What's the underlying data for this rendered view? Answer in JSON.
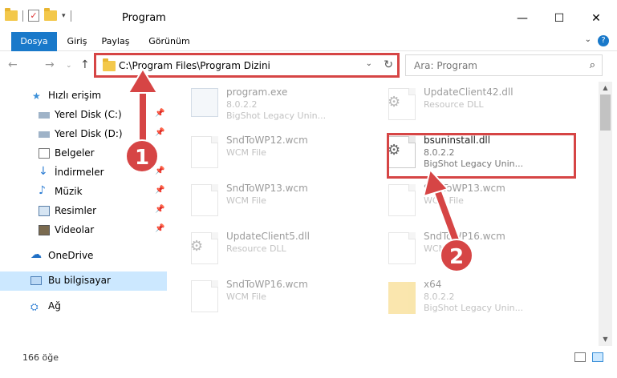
{
  "window": {
    "title": "Program",
    "minimize": "—",
    "maximize": "☐",
    "close": "✕"
  },
  "ribbon": {
    "tabs": [
      "Dosya",
      "Giriş",
      "Paylaş",
      "Görünüm"
    ],
    "active": "Dosya"
  },
  "address": {
    "path": "C:\\Program Files\\Program Dizini"
  },
  "search": {
    "placeholder": "Ara: Program"
  },
  "sidebar": {
    "items": [
      {
        "label": "Hızlı erişim",
        "icon": "star-icon"
      },
      {
        "label": "Yerel Disk (C:)",
        "icon": "drive-icon"
      },
      {
        "label": "Yerel Disk (D:)",
        "icon": "drive-icon"
      },
      {
        "label": "Belgeler",
        "icon": "documents-icon"
      },
      {
        "label": "İndirmeler",
        "icon": "download-icon"
      },
      {
        "label": "Müzik",
        "icon": "music-icon"
      },
      {
        "label": "Resimler",
        "icon": "pictures-icon"
      },
      {
        "label": "Videolar",
        "icon": "videos-icon"
      },
      {
        "label": "OneDrive",
        "icon": "cloud-icon"
      },
      {
        "label": "Bu bilgisayar",
        "icon": "computer-icon"
      },
      {
        "label": "Ağ",
        "icon": "network-icon"
      }
    ]
  },
  "files": [
    {
      "name": "program.exe",
      "line2": "8.0.2.2",
      "line3": "BigShot Legacy Unin..."
    },
    {
      "name": "UpdateClient42.dll",
      "line2": "Resource DLL",
      "line3": ""
    },
    {
      "name": "SndToWP12.wcm",
      "line2": "WCM File",
      "line3": ""
    },
    {
      "name": "bsuninstall.dll",
      "line2": "8.0.2.2",
      "line3": "BigShot Legacy Unin..."
    },
    {
      "name": "SndToWP13.wcm",
      "line2": "WCM File",
      "line3": ""
    },
    {
      "name": "SndToWP13.wcm",
      "line2": "WCM File",
      "line3": ""
    },
    {
      "name": "UpdateClient5.dll",
      "line2": "Resource DLL",
      "line3": ""
    },
    {
      "name": "SndToWP16.wcm",
      "line2": "WCM File",
      "line3": ""
    },
    {
      "name": "SndToWP16.wcm",
      "line2": "WCM File",
      "line3": ""
    },
    {
      "name": "x64",
      "line2": "8.0.2.2",
      "line3": "BigShot Legacy Unin..."
    }
  ],
  "status": {
    "count": "166 öğe"
  },
  "annotations": {
    "step1": "1",
    "step2": "2",
    "highlight_color": "#d64545"
  }
}
